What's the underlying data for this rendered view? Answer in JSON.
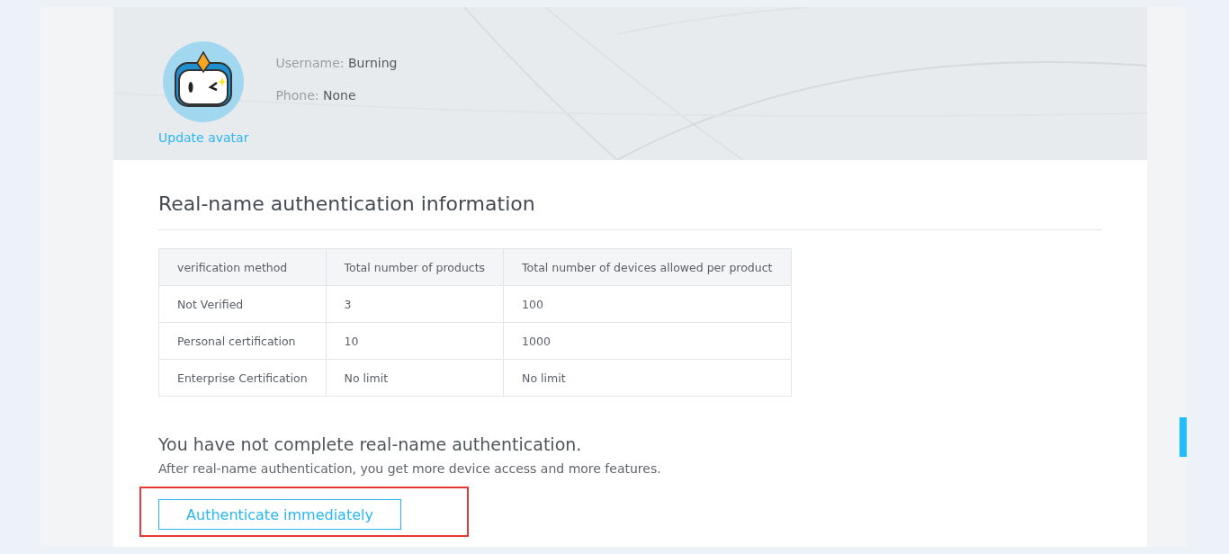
{
  "profile": {
    "username_label": "Username:",
    "username": "Burning",
    "phone_label": "Phone:",
    "phone": "None",
    "update_avatar": "Update avatar"
  },
  "section": {
    "title": "Real-name authentication information"
  },
  "table": {
    "columns": [
      "verification method",
      "Total number of products",
      "Total number of devices allowed per product"
    ],
    "rows": [
      [
        "Not Verified",
        "3",
        "100"
      ],
      [
        "Personal certification",
        "10",
        "1000"
      ],
      [
        "Enterprise Certification",
        "No limit",
        "No limit"
      ]
    ]
  },
  "notice": {
    "title": "You have not complete real-name authentication.",
    "text": "After real-name authentication, you get more device access and more features.",
    "button": "Authenticate immediately"
  }
}
